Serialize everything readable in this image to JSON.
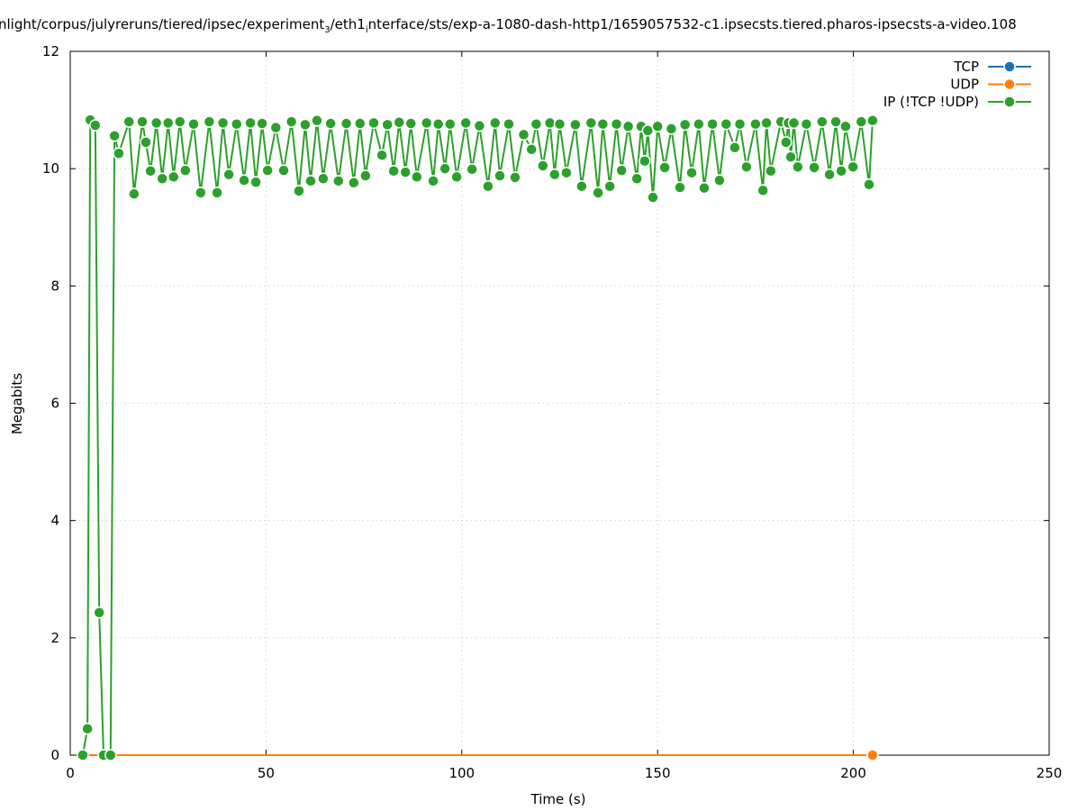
{
  "chart_data": {
    "type": "line",
    "title_parts": [
      "nlight/corpus/julyreruns/tiered/ipsec/experiment",
      "3",
      "/eth1",
      "i",
      "nterface/sts/exp-a-1080-dash-http1/1659057532-c1.ipsecsts.tiered.pharos-ipsecsts-a-video.108"
    ],
    "xlabel": "Time (s)",
    "ylabel": "Megabits",
    "xlim": [
      0,
      250
    ],
    "ylim": [
      0,
      12
    ],
    "xticks": [
      0,
      50,
      100,
      150,
      200,
      250
    ],
    "yticks": [
      0,
      2,
      4,
      6,
      8,
      10,
      12
    ],
    "grid": true,
    "legend_position": "top-right",
    "series": [
      {
        "name": "TCP",
        "color": "#1f6fb9",
        "points": []
      },
      {
        "name": "UDP",
        "color": "#ff7f0e",
        "points": [
          [
            3.2,
            0
          ],
          [
            204.9,
            0
          ]
        ],
        "markers_only_last": true
      },
      {
        "name": "IP (!TCP  !UDP)",
        "color": "#2ca02c",
        "points": [
          [
            3.2,
            0
          ],
          [
            4.4,
            0.45
          ],
          [
            5.1,
            10.83
          ],
          [
            6.4,
            10.74
          ],
          [
            7.4,
            2.43
          ],
          [
            8.5,
            0
          ],
          [
            10.3,
            0
          ],
          [
            11.3,
            10.56
          ],
          [
            12.4,
            10.26
          ],
          [
            15,
            10.8
          ],
          [
            16.3,
            9.57
          ],
          [
            18.4,
            10.8
          ],
          [
            19.3,
            10.45
          ],
          [
            20.5,
            9.96
          ],
          [
            22,
            10.78
          ],
          [
            23.5,
            9.83
          ],
          [
            25,
            10.78
          ],
          [
            26.4,
            9.86
          ],
          [
            28,
            10.8
          ],
          [
            29.4,
            9.97
          ],
          [
            31.5,
            10.76
          ],
          [
            33.3,
            9.59
          ],
          [
            35.5,
            10.8
          ],
          [
            37.5,
            9.59
          ],
          [
            39,
            10.78
          ],
          [
            40.5,
            9.9
          ],
          [
            42.5,
            10.76
          ],
          [
            44.4,
            9.8
          ],
          [
            46,
            10.78
          ],
          [
            47.4,
            9.77
          ],
          [
            49,
            10.77
          ],
          [
            50.4,
            9.97
          ],
          [
            52.5,
            10.7
          ],
          [
            54.5,
            9.97
          ],
          [
            56.5,
            10.8
          ],
          [
            58.4,
            9.62
          ],
          [
            60,
            10.75
          ],
          [
            61.4,
            9.79
          ],
          [
            63,
            10.82
          ],
          [
            64.6,
            9.83
          ],
          [
            66.5,
            10.77
          ],
          [
            68.5,
            9.79
          ],
          [
            70.5,
            10.77
          ],
          [
            72.4,
            9.76
          ],
          [
            74,
            10.77
          ],
          [
            75.4,
            9.88
          ],
          [
            77.5,
            10.78
          ],
          [
            79.6,
            10.23
          ],
          [
            81,
            10.75
          ],
          [
            82.6,
            9.96
          ],
          [
            84,
            10.79
          ],
          [
            85.6,
            9.94
          ],
          [
            87,
            10.77
          ],
          [
            88.5,
            9.86
          ],
          [
            91,
            10.78
          ],
          [
            92.7,
            9.79
          ],
          [
            94,
            10.76
          ],
          [
            95.7,
            10.0
          ],
          [
            97,
            10.76
          ],
          [
            98.7,
            9.86
          ],
          [
            101,
            10.78
          ],
          [
            102.6,
            9.99
          ],
          [
            104.5,
            10.73
          ],
          [
            106.7,
            9.7
          ],
          [
            108.5,
            10.78
          ],
          [
            109.7,
            9.88
          ],
          [
            112,
            10.76
          ],
          [
            113.6,
            9.85
          ],
          [
            115.8,
            10.58
          ],
          [
            117.8,
            10.33
          ],
          [
            119,
            10.76
          ],
          [
            120.7,
            10.05
          ],
          [
            122.5,
            10.78
          ],
          [
            123.7,
            9.9
          ],
          [
            125,
            10.76
          ],
          [
            126.7,
            9.93
          ],
          [
            129,
            10.75
          ],
          [
            130.6,
            9.7
          ],
          [
            133,
            10.78
          ],
          [
            134.8,
            9.59
          ],
          [
            136,
            10.76
          ],
          [
            137.8,
            9.7
          ],
          [
            139.5,
            10.76
          ],
          [
            140.8,
            9.97
          ],
          [
            142.5,
            10.72
          ],
          [
            144.7,
            9.83
          ],
          [
            145.8,
            10.72
          ],
          [
            146.7,
            10.13
          ],
          [
            147.5,
            10.65
          ],
          [
            148.8,
            9.51
          ],
          [
            150,
            10.72
          ],
          [
            151.8,
            10.02
          ],
          [
            153.5,
            10.68
          ],
          [
            155.7,
            9.68
          ],
          [
            157,
            10.75
          ],
          [
            158.7,
            9.93
          ],
          [
            160.5,
            10.76
          ],
          [
            161.9,
            9.67
          ],
          [
            164,
            10.76
          ],
          [
            165.8,
            9.8
          ],
          [
            167.5,
            10.76
          ],
          [
            169.7,
            10.36
          ],
          [
            171,
            10.76
          ],
          [
            172.7,
            10.03
          ],
          [
            175,
            10.76
          ],
          [
            176.9,
            9.63
          ],
          [
            177.8,
            10.78
          ],
          [
            178.9,
            9.96
          ],
          [
            181.5,
            10.8
          ],
          [
            182.8,
            10.45
          ],
          [
            183.4,
            10.78
          ],
          [
            184.0,
            10.2
          ],
          [
            184.8,
            10.78
          ],
          [
            185.8,
            10.03
          ],
          [
            188,
            10.76
          ],
          [
            190,
            10.02
          ],
          [
            192,
            10.8
          ],
          [
            193.9,
            9.9
          ],
          [
            195.5,
            10.8
          ],
          [
            196.9,
            9.96
          ],
          [
            198,
            10.72
          ],
          [
            199.9,
            10.03
          ],
          [
            202,
            10.8
          ],
          [
            204,
            9.73
          ],
          [
            204.9,
            10.82
          ]
        ]
      }
    ]
  }
}
